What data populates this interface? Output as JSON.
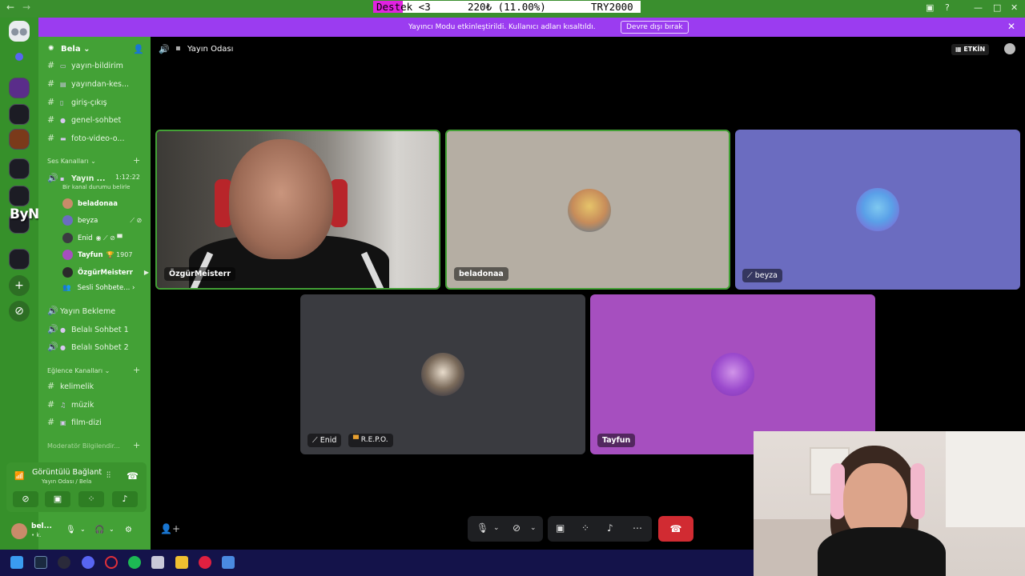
{
  "overlay": {
    "donate_label": "Destek <3",
    "donate_amount": "220₺ (11.00%)",
    "donate_goal": "TRY2000",
    "donate_progress_percent": 11,
    "brand_logo": "ByNoGame"
  },
  "banner": {
    "message": "Yayıncı Modu etkinleştirildi. Kullanıcı adları kısaltıldı.",
    "button": "Devre dışı bırak"
  },
  "server": {
    "name": "Bela"
  },
  "channels": {
    "text_top": [
      {
        "label": "yayın-bildirim"
      },
      {
        "label": "yayından-kes..."
      },
      {
        "label": "giriş-çıkış"
      },
      {
        "label": "genel-sohbet"
      },
      {
        "label": "foto-video-o..."
      }
    ],
    "voice_category": "Ses Kanalları",
    "active_voice": {
      "label": "Yayın ...",
      "timer": "1:12:22",
      "status": "Bir kanal durumu belirle"
    },
    "voice_users": [
      {
        "name": "beladonaa"
      },
      {
        "name": "beyza"
      },
      {
        "name": "Enid"
      },
      {
        "name": "Tayfun",
        "badge": "1907"
      },
      {
        "name": "ÖzgürMeisterr"
      }
    ],
    "sesli_sohbet": "Sesli Sohbete...",
    "voice_others": [
      {
        "label": "Yayın Bekleme"
      },
      {
        "label": "Belalı Sohbet 1"
      },
      {
        "label": "Belalı Sohbet 2"
      }
    ],
    "fun_category": "Eğlence Kanalları",
    "fun_channels": [
      {
        "label": "kelimelik"
      },
      {
        "label": "müzik"
      },
      {
        "label": "film-dizi"
      }
    ],
    "mod_category": "Moderatör Bilgilendir..."
  },
  "voice_panel": {
    "status": "Görüntülü Bağlant",
    "location": "Yayın Odası / Bela"
  },
  "user": {
    "name": "bel...",
    "status": "• k."
  },
  "main": {
    "room_title": "Yayın Odası",
    "activity_label": "ETKİN",
    "tiles": [
      {
        "name": "ÖzgürMeisterr"
      },
      {
        "name": "beladonaa"
      },
      {
        "name": "beyza"
      },
      {
        "name": "Enid",
        "game": "R.E.P.O."
      },
      {
        "name": "Tayfun"
      }
    ]
  },
  "colors": {
    "rail": "#36902a",
    "sidebar": "#43a136",
    "banner": "#9b3cf0",
    "tile_beladonaa": "#b5aea3",
    "tile_beyza": "#6b6cc0",
    "tile_enid": "#3a3b40",
    "tile_tayfun": "#a64fbf",
    "leave_button": "#d12b32"
  }
}
